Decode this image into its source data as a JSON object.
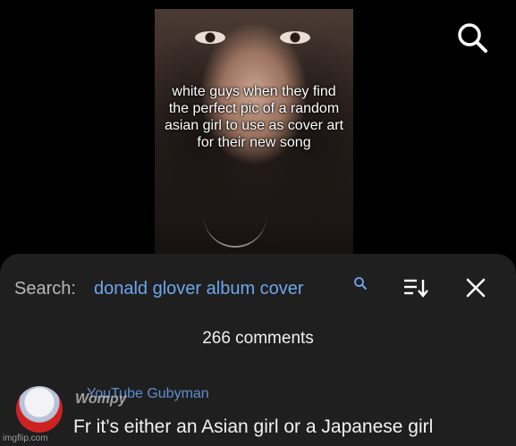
{
  "video": {
    "caption": "white guys when they find the perfect pic of a random asian girl to use as cover art for their new song"
  },
  "top_bar": {
    "search_icon": "search-icon"
  },
  "comments_sheet": {
    "search_label": "Search:",
    "search_term": "donald glover album cover",
    "sort_icon": "sort-icon",
    "close_icon": "close-icon",
    "comment_count": "266 comments",
    "comments": [
      {
        "author": "YouTube Gubyman",
        "overlay_text": "Wompy",
        "text": "Fr it’s either an Asian girl or a Japanese girl"
      }
    ]
  },
  "watermark": "imgflip.com",
  "colors": {
    "accent": "#6ea6ec",
    "sheet_bg": "#1f1f1f"
  }
}
